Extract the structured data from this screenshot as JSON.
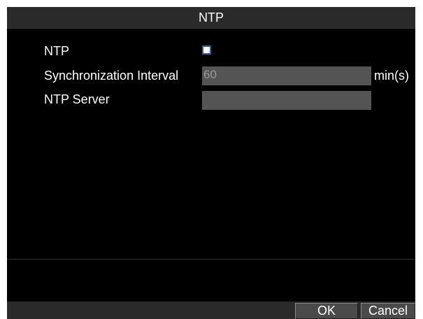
{
  "dialog": {
    "title": "NTP"
  },
  "form": {
    "ntp_label": "NTP",
    "ntp_enabled": false,
    "interval_label": "Synchronization Interval",
    "interval_value": "60",
    "interval_unit": "min(s)",
    "server_label": "NTP Server",
    "server_value": ""
  },
  "buttons": {
    "ok_label": "OK",
    "cancel_label": "Cancel"
  },
  "colors": {
    "background": "#000000",
    "titlebar": "#2a2a2a",
    "field": "#545454",
    "checkbox_border": "#2f55c6",
    "text": "#ffffff"
  }
}
